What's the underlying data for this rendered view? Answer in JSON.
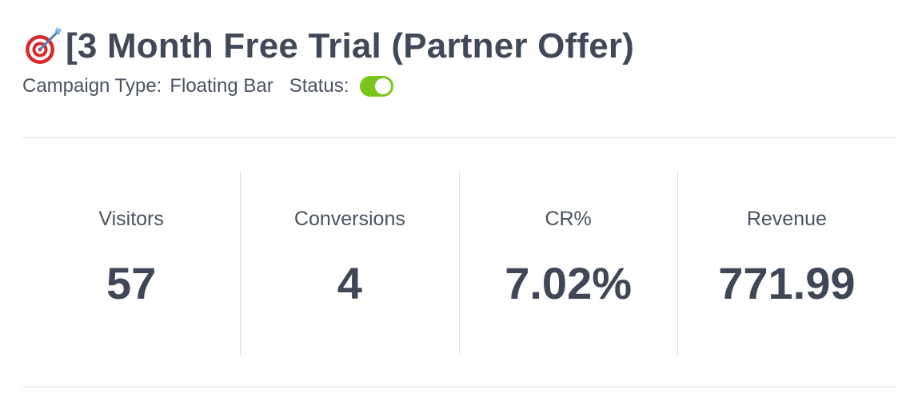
{
  "campaign": {
    "title": "[3 Month Free Trial (Partner Offer)",
    "title_icon": "dart-target-icon",
    "type_label": "Campaign Type:",
    "type_value": "Floating Bar",
    "status_label": "Status:",
    "status_enabled": true
  },
  "stats": [
    {
      "label": "Visitors",
      "value": "57"
    },
    {
      "label": "Conversions",
      "value": "4"
    },
    {
      "label": "CR%",
      "value": "7.02%"
    },
    {
      "label": "Revenue",
      "value": "771.99"
    }
  ],
  "colors": {
    "toggle_on": "#79c51e",
    "text": "#3f4656",
    "divider": "#d5e3ef",
    "target_red": "#d8282c"
  }
}
